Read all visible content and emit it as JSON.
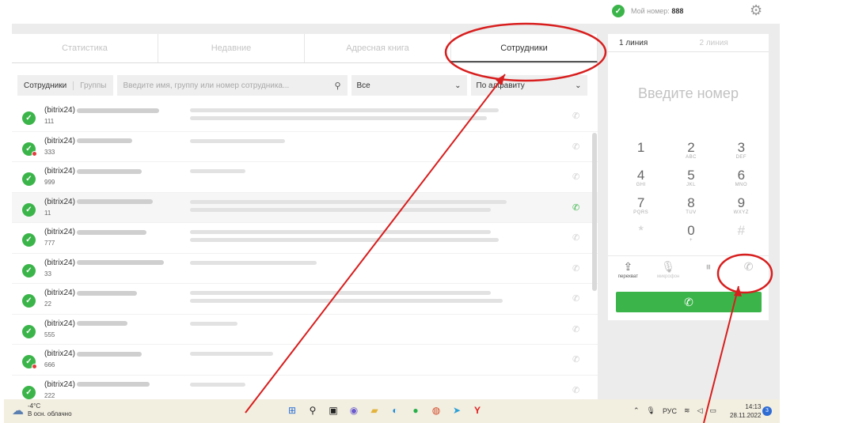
{
  "header": {
    "my_number_label": "Мой номер:",
    "my_number": "888"
  },
  "tabs": [
    {
      "label": "Статистика"
    },
    {
      "label": "Недавние"
    },
    {
      "label": "Адресная книга"
    },
    {
      "label": "Сотрудники"
    }
  ],
  "filter": {
    "seg_a": "Сотрудники",
    "seg_b": "Группы",
    "search_placeholder": "Введите имя, группу или номер сотрудника...",
    "select_all": "Все",
    "select_sort": "По алфавиту"
  },
  "employees": [
    {
      "prefix": "(bitrix24)",
      "ext": "111"
    },
    {
      "prefix": "(bitrix24)",
      "ext": "333"
    },
    {
      "prefix": "(bitrix24)",
      "ext": "999"
    },
    {
      "prefix": "(bitrix24)",
      "ext": "11"
    },
    {
      "prefix": "(bitrix24)",
      "ext": "777"
    },
    {
      "prefix": "(bitrix24)",
      "ext": "33"
    },
    {
      "prefix": "(bitrix24)",
      "ext": "22"
    },
    {
      "prefix": "(bitrix24)",
      "ext": "555"
    },
    {
      "prefix": "(bitrix24)",
      "ext": "666"
    },
    {
      "prefix": "(bitrix24)",
      "ext": "222"
    }
  ],
  "dialer": {
    "line1": "1 линия",
    "line2": "2 линия",
    "input_placeholder": "Введите номер",
    "keys": [
      {
        "d": "1",
        "l": ""
      },
      {
        "d": "2",
        "l": "ABC"
      },
      {
        "d": "3",
        "l": "DEF"
      },
      {
        "d": "4",
        "l": "GHI"
      },
      {
        "d": "5",
        "l": "JKL"
      },
      {
        "d": "6",
        "l": "MNO"
      },
      {
        "d": "7",
        "l": "PQRS"
      },
      {
        "d": "8",
        "l": "TUV"
      },
      {
        "d": "9",
        "l": "WXYZ"
      },
      {
        "d": "*",
        "l": ""
      },
      {
        "d": "0",
        "l": "+"
      },
      {
        "d": "#",
        "l": ""
      }
    ],
    "actions": [
      {
        "label": "перехват"
      },
      {
        "label": "микрофон"
      },
      {
        "label": ""
      },
      {
        "label": ""
      }
    ]
  },
  "taskbar": {
    "temp": "-4°C",
    "weather": "В осн. облачно",
    "lang": "РУС",
    "time": "14:13",
    "date": "28.11.2022",
    "notifications": "3"
  },
  "colors": {
    "accent_green": "#3bb54a",
    "annotation_red": "#d81e1e"
  }
}
